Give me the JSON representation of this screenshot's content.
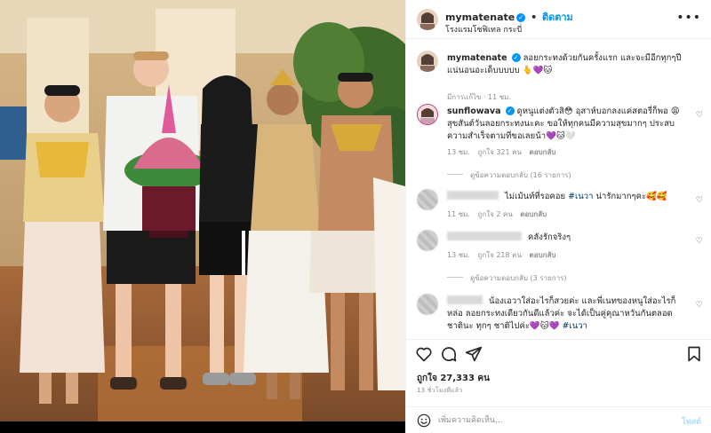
{
  "post": {
    "username": "mymatenate",
    "follow_label": "ติดตาม",
    "location": "โรงแรมโซฟิเทล กระบี่",
    "separator": "•"
  },
  "caption": {
    "username": "mymatenate",
    "text": "ลอยกระทงด้วยกันครั้งแรก และจะมีอีกทุกๆปีแน่นอนอะเด็บบบบบ 🫰💜🐱",
    "edited": "มีการแก้ไข · 11 ชม."
  },
  "comments": [
    {
      "username": "sunflowava",
      "text": "ดูหนูแต่งตัวสิ😳 อุสาห์บอกลงแค่สตอรี่ก็พอ 😩 สุขสันต์วันลอยกระทงนะคะ ขอให้ทุกคนมีความสุขมากๆ ประสบความสำเร็จตามที่ขอเลยน้า💜🐱🤍",
      "time": "13 ชม.",
      "likes": "ถูกใจ 321 คน",
      "reply": "ตอบกลับ",
      "view_replies": "ดูข้อความตอบกลับ (16 รายการ)"
    },
    {
      "text": "ไม่เม้นท์ที่รอคอย",
      "hashtag": "#เนวา",
      "text2": "น่ารักมากๆคะ🥰🥰",
      "time": "11 ชม.",
      "likes": "ถูกใจ 2 คน",
      "reply": "ตอบกลับ"
    },
    {
      "text": "คลังรักจริงๆ",
      "time": "13 ชม.",
      "likes": "ถูกใจ 218 คน",
      "reply": "ตอบกลับ",
      "view_replies": "ดูข้อความตอบกลับ (3 รายการ)"
    },
    {
      "text": "น้องเอวาใส่อะไรก็สวยค่ะ และพี่เนทของหนูใส่อะไรก็หล่อ ลอยกระทงเดียวกันดีแล้วค่ะ จะได้เป็นคู่คุณาหวันกันตลอดชาตินะ ทุกๆ ชาติไปค่ะ💜🐱💜",
      "hashtag": "#เนวา"
    }
  ],
  "footer": {
    "likes": "ถูกใจ 27,333 คน",
    "time": "13 ชั่วโมงที่แล้ว",
    "comment_placeholder": "เพิ่มความคิดเห็น...",
    "post_label": "โพสต์"
  },
  "icons": {
    "more": "more-options-icon",
    "heart": "heart-icon",
    "comment": "comment-icon",
    "share": "share-icon",
    "save": "bookmark-icon",
    "emoji": "emoji-icon"
  },
  "colors": {
    "accent": "#0095f6",
    "text": "#262626",
    "muted": "#8e8e8e",
    "hashtag": "#00376b"
  }
}
